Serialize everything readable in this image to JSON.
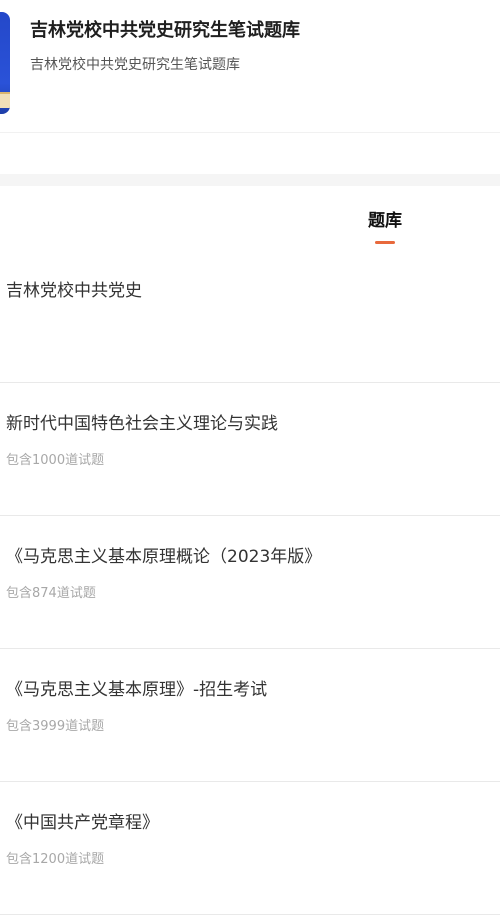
{
  "header": {
    "title": "吉林党校中共党史研究生笔试题库",
    "subtitle": "吉林党校中共党史研究生笔试题库",
    "cover_color": "#2448c9"
  },
  "tabs": [
    {
      "label": "题库",
      "active": true
    }
  ],
  "accent_color": "#e8693c",
  "list": {
    "items": [
      {
        "title": "吉林党校中共党史",
        "count": ""
      },
      {
        "title": "新时代中国特色社会主义理论与实践",
        "count": "包含1000道试题"
      },
      {
        "title": "《马克思主义基本原理概论（2023年版》",
        "count": "包含874道试题"
      },
      {
        "title": "《马克思主义基本原理》-招生考试",
        "count": "包含3999道试题"
      },
      {
        "title": "《中国共产党章程》",
        "count": "包含1200道试题"
      }
    ]
  }
}
